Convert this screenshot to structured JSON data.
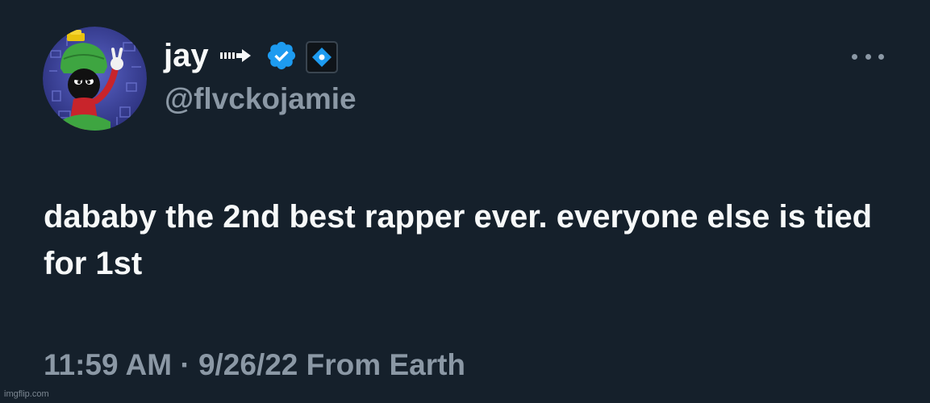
{
  "tweet": {
    "author": {
      "display_name": "jay",
      "handle": "@flvckojamie",
      "avatar_icon": "marvin-martian-avatar",
      "badges": [
        "arrow-right-icon",
        "verified-badge-icon",
        "affiliate-badge-icon"
      ]
    },
    "text": "dababy the 2nd best rapper ever. everyone else is tied for 1st",
    "time": "11:59 AM",
    "separator": "·",
    "date": "9/26/22",
    "source": "From Earth",
    "more_icon": "more-options-icon"
  },
  "watermark": "imgflip.com",
  "colors": {
    "background": "#15202b",
    "primary_text": "#f7f9f9",
    "secondary_text": "#8b98a5",
    "verified_blue": "#1d9bf0"
  }
}
